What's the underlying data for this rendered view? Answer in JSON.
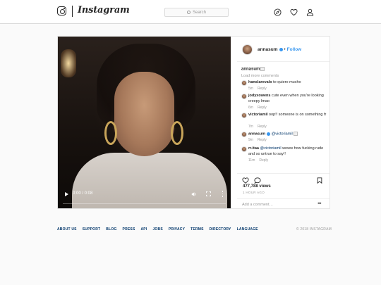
{
  "header": {
    "brand": "Instagram",
    "search_placeholder": "Search",
    "nav_icons": [
      "explore-icon",
      "heart-icon",
      "profile-icon"
    ]
  },
  "post": {
    "video": {
      "time_display": "0:00 / 0:08",
      "progress": 0.0
    },
    "author": {
      "username": "annasum",
      "follow_label": "Follow",
      "separator": "•"
    },
    "caption_user": "annasum",
    "load_more": "Load more comments",
    "comments": [
      {
        "user": "hanslarevalo",
        "text": "te quiero mucho",
        "age": "5m",
        "reply": "Reply"
      },
      {
        "user": "jodyxowens",
        "text": "cute even when you're looking creepy lmao",
        "age": "6m",
        "reply": "Reply"
      },
      {
        "user": "victoriamil",
        "text": "oop!! someone is on something fr",
        "age": "7m",
        "reply": "Reply"
      },
      {
        "user": "annasum",
        "mention": "@victoriamil",
        "text": "",
        "age": "9m",
        "reply": "Reply"
      },
      {
        "user": "rr.itaa",
        "mention": "@victoriamil",
        "text": "woww how fucking rude and so untrue to say!!",
        "age": "11m",
        "reply": "Reply"
      }
    ],
    "views": "477,788 views",
    "time_ago": "1 HOUR AGO",
    "add_comment_placeholder": "Add a comment…",
    "more_label": "•••"
  },
  "footer": {
    "links": [
      "ABOUT US",
      "SUPPORT",
      "BLOG",
      "PRESS",
      "API",
      "JOBS",
      "PRIVACY",
      "TERMS",
      "DIRECTORY",
      "LANGUAGE"
    ],
    "copyright": "© 2018 INSTAGRAM"
  },
  "colors": {
    "accent": "#3897f0",
    "link": "#003569",
    "text": "#262626",
    "muted": "#999999",
    "border": "#dbdbdb"
  }
}
